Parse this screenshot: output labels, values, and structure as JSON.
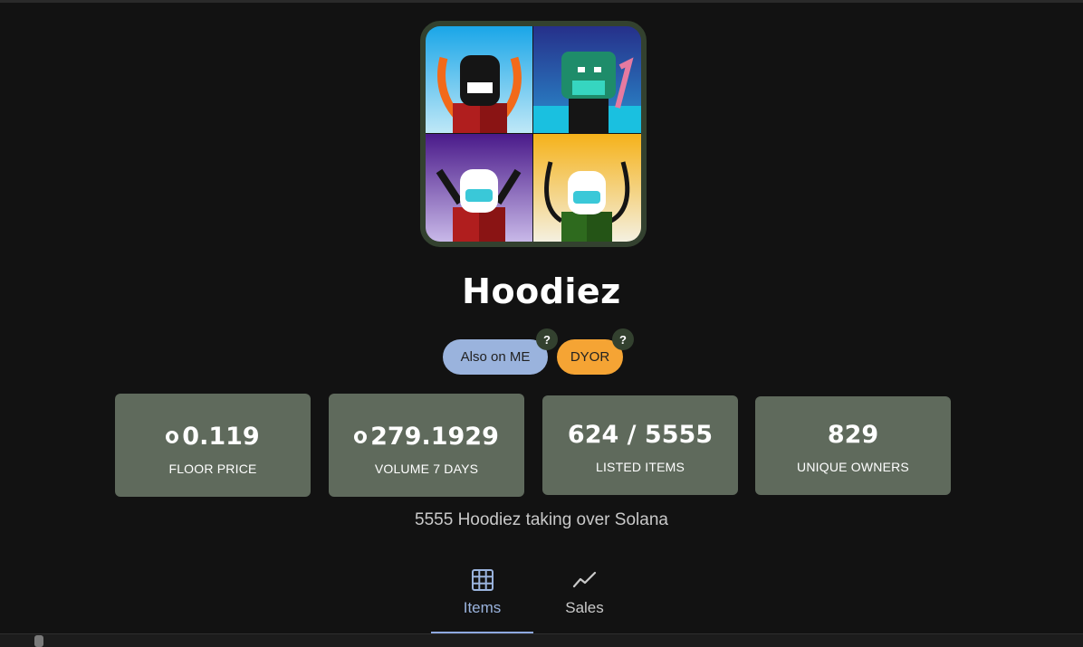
{
  "collection": {
    "name": "Hoodiez",
    "description": "5555 Hoodiez taking over Solana"
  },
  "badges": [
    {
      "label": "Also on ME",
      "help": "?",
      "color": "#9ab3dd"
    },
    {
      "label": "DYOR",
      "help": "?",
      "color": "#f5a434"
    }
  ],
  "stats": [
    {
      "value": "0.119",
      "label": "FLOOR PRICE",
      "icon": "solana-icon"
    },
    {
      "value": "279.1929",
      "label": "VOLUME 7 DAYS",
      "icon": "solana-icon"
    },
    {
      "value": "624 / 5555",
      "label": "LISTED ITEMS"
    },
    {
      "value": "829",
      "label": "UNIQUE OWNERS"
    }
  ],
  "tabs": [
    {
      "label": "Items",
      "icon": "grid-icon",
      "active": true
    },
    {
      "label": "Sales",
      "icon": "trend-line-icon",
      "active": false
    }
  ],
  "colors": {
    "background": "#121212",
    "card": "#5f6a5c",
    "accent": "#9ab3dd",
    "dyor": "#f5a434"
  }
}
